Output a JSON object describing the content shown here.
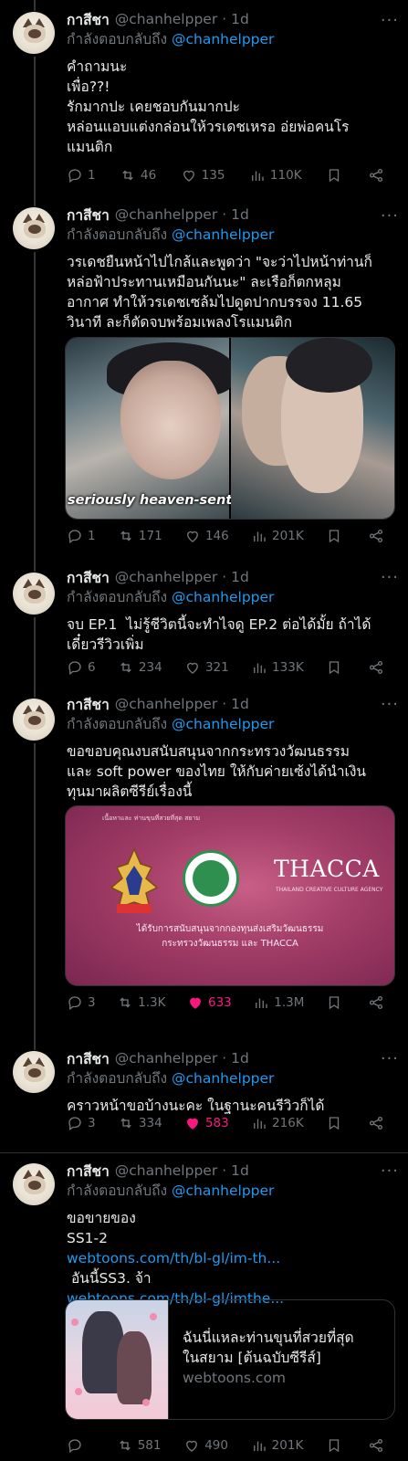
{
  "author": {
    "name": "กาสีชา",
    "handle": "@chanhelpper",
    "time": "1d"
  },
  "reply_prefix": "กำลังตอบกลับถึง",
  "reply_mention": "@chanhelpper",
  "more_glyph": "···",
  "tweets": [
    {
      "text": "คำถามนะ\nเพื่อ??!\nรักมากปะ เคยชอบกันมากปะ\nหล่อนแอบแต่งกล่อนให้วรเดชเหรอ อ่ยพ่อคนโร\nแมนติก",
      "replies": "1",
      "retweets": "46",
      "likes": "135",
      "views": "110K",
      "liked": false
    },
    {
      "text": "วรเดชยืนหน้าไปไกล้และพูดว่า \"จะว่าไปหน้าท่านก็\nหล่อฟ้าประทานเหมือนกันนะ\" ละเรือก็ตกหลุม\nอากาศ ทำให้วรเดชเซล้มไปดูดปากบรรจง 11.65\nวินาที ละก็ตัดจบพร้อมเพลงโรแมนติก",
      "media_caption": "seriously heaven-sent.",
      "replies": "1",
      "retweets": "171",
      "likes": "146",
      "views": "201K",
      "liked": false
    },
    {
      "text": "จบ EP.1  ไม่รู้ชีวิตนี้จะทำไจดู EP.2 ต่อได้มั้ย ถ้าได้\nเดี๋ยวรีวิวเพิ่ม",
      "replies": "6",
      "retweets": "234",
      "likes": "321",
      "views": "133K",
      "liked": false
    },
    {
      "text": "ขอขอบคุณงบสนับสนุนจากกระทรวงวัฒนธรรม\nและ soft power ของไทย ให้กับค่ายเซ้งได้นำเงิน\nทุนมาผลิตซีรีย์เรื่องนี้",
      "media": {
        "top_line": "เนื้อหาและ ท่านขุนที่สวยที่สุด สยาม",
        "brand": "THACCA",
        "brand_sub": "THAILAND CREATIVE CULTURE AGENCY",
        "line1": "ได้รับการสนับสนุนจากกองทุนส่งเสริมวัฒนธรรม",
        "line2": "กระทรวงวัฒนธรรม และ THACCA"
      },
      "replies": "3",
      "retweets": "1.3K",
      "likes": "633",
      "views": "1.3M",
      "liked": true
    },
    {
      "text": "คราวหน้าขอบ้างนะคะ ในฐานะคนรีวิวก็ได้",
      "replies": "3",
      "retweets": "334",
      "likes": "583",
      "views": "216K",
      "liked": true
    },
    {
      "text_lines": [
        {
          "text": "ขอขายของ",
          "link": false
        },
        {
          "text": "SS1-2",
          "link": false
        },
        {
          "text": "webtoons.com/th/bl-gl/im-th...",
          "link": true
        },
        {
          "text": " อันนี้SS3. จ้า",
          "link": false
        },
        {
          "text": "webtoons.com/th/bl-gl/imthe...",
          "link": true
        }
      ],
      "card": {
        "title": "ฉันนี่แหละท่านขุนที่สวยที่สุด\nในสยาม [ต้นฉบับซีรีส์]",
        "domain": "webtoons.com"
      },
      "replies": "",
      "retweets": "581",
      "likes": "490",
      "views": "201K",
      "liked": false
    }
  ],
  "colors": {
    "accent": "#1d9bf0",
    "like": "#f91880",
    "muted": "#71767b",
    "text": "#e7e9ea",
    "bg": "#000000"
  }
}
